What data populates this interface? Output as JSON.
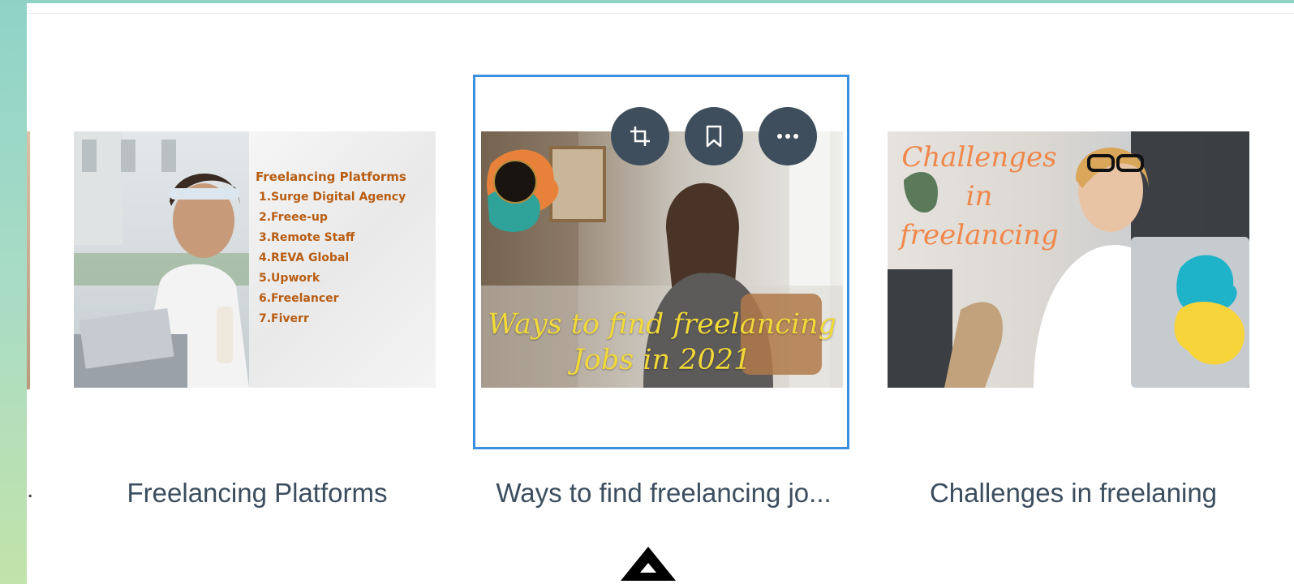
{
  "colors": {
    "selection_outline": "#3d8fe0",
    "toolbar_button": "#3f4e5c",
    "caption_text": "#3b4d5e"
  },
  "toolbar": {
    "crop_icon": "crop-icon",
    "bookmark_icon": "bookmark-icon",
    "more_icon": "more-icon"
  },
  "cards": [
    {
      "caption": "Freelancing Platforms",
      "thumbnail": {
        "heading": "Freelancing Platforms",
        "list": [
          "1.Surge Digital Agency",
          "2.Freee-up",
          "3.Remote Staff",
          "4.REVA Global",
          "5.Upwork",
          "6.Freelancer",
          "7.Fiverr"
        ]
      }
    },
    {
      "caption": "Ways to find freelancing jo...",
      "selected": true,
      "thumbnail": {
        "overlay_line1": "Ways to find freelancing",
        "overlay_line2": "Jobs in 2021"
      }
    },
    {
      "caption": "Challenges in freelaning",
      "thumbnail": {
        "overlay_line1": "Challenges",
        "overlay_line2": "in",
        "overlay_line3": "freelancing"
      }
    }
  ],
  "edge_card_caption_tail": "."
}
